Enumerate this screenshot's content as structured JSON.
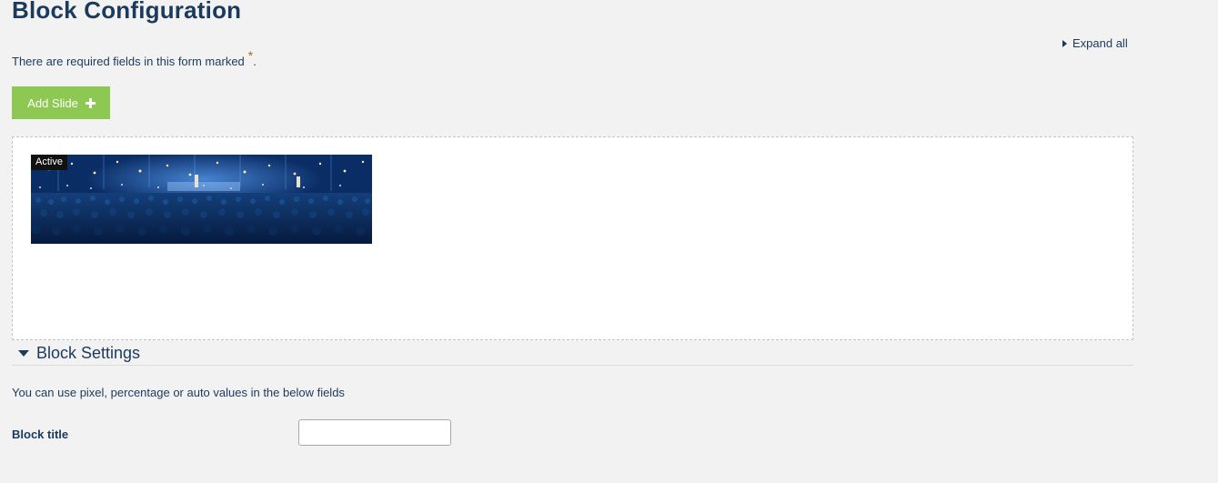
{
  "page": {
    "title": "Block Configuration",
    "expand_all_label": "Expand all",
    "required_note": "There are required fields in this form marked",
    "required_marker": "*",
    "required_note_end": "."
  },
  "toolbar": {
    "add_slide_label": "Add Slide",
    "add_slide_icon": "plus-icon",
    "add_slide_color": "#8cc852"
  },
  "slides": [
    {
      "status_badge": "Active",
      "thumbnail": "concert-crowd-stage-image"
    }
  ],
  "block_settings": {
    "section_title": "Block Settings",
    "section_icon": "caret-down-icon",
    "hint": "You can use pixel, percentage or auto values in the below fields",
    "fields": [
      {
        "label": "Block title",
        "value": "",
        "placeholder": ""
      }
    ]
  },
  "colors": {
    "background": "#f2f2f2",
    "text": "#1b3a5c",
    "required_star": "#b06a2a"
  }
}
